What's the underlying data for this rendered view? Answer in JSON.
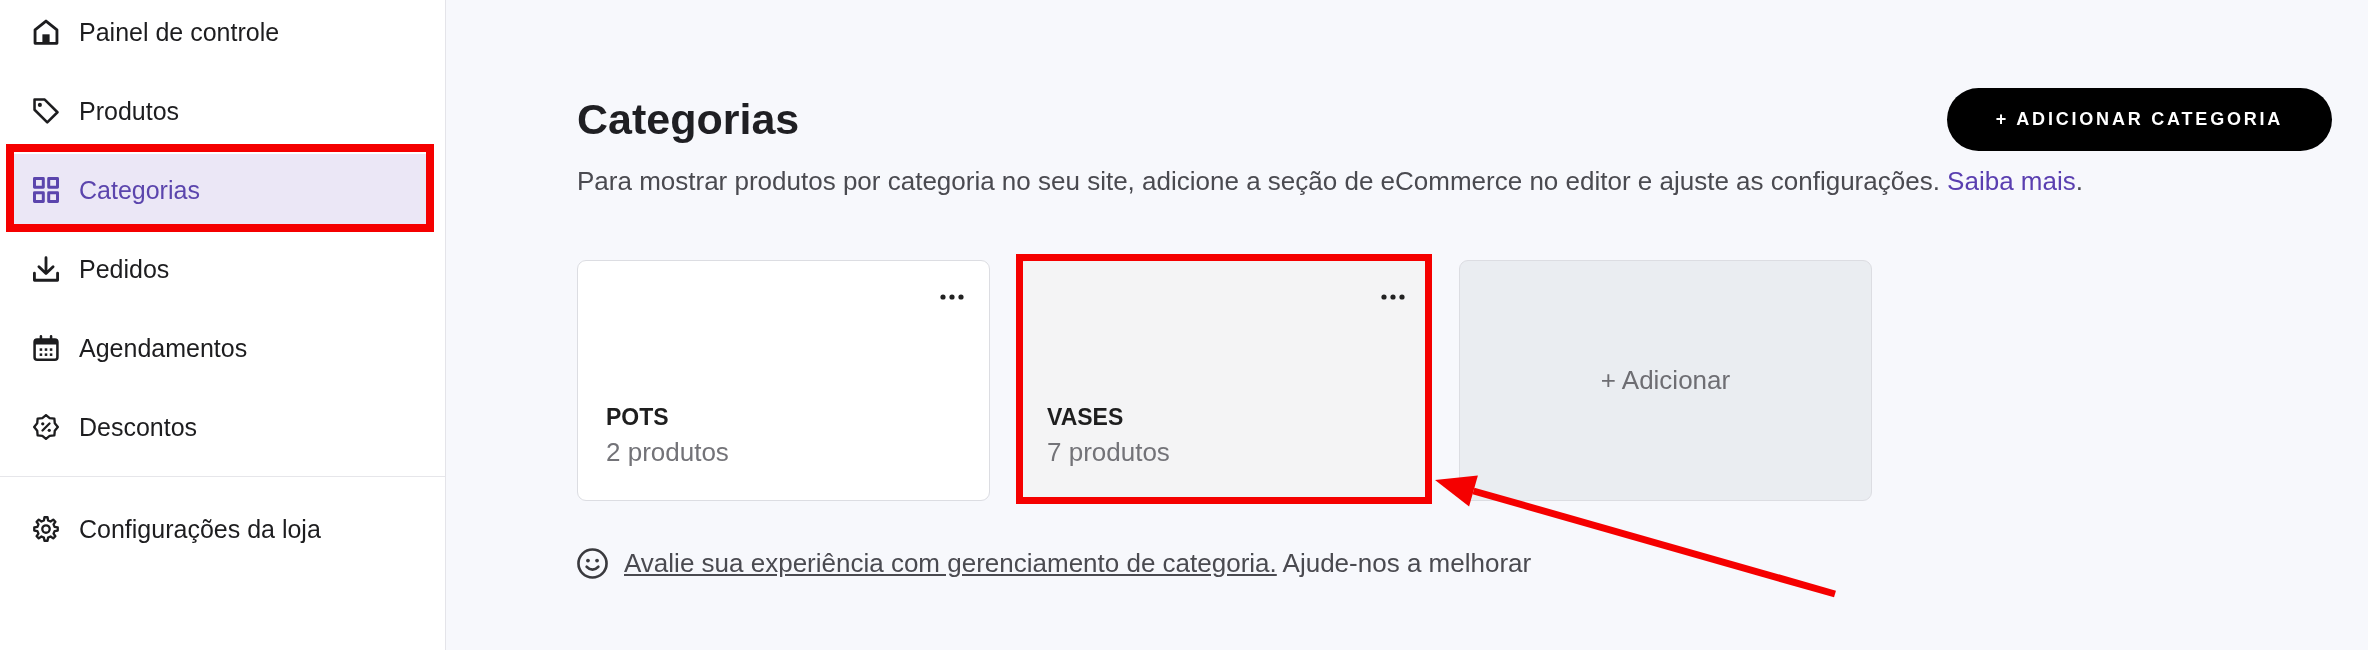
{
  "sidebar": {
    "groups": [
      {
        "items": [
          {
            "label": "Painel de controle",
            "selected": false,
            "highlighted": false
          },
          {
            "label": "Produtos",
            "selected": false,
            "highlighted": false
          },
          {
            "label": "Categorias",
            "selected": true,
            "highlighted": true
          },
          {
            "label": "Pedidos",
            "selected": false,
            "highlighted": false
          },
          {
            "label": "Agendamentos",
            "selected": false,
            "highlighted": false
          },
          {
            "label": "Descontos",
            "selected": false,
            "highlighted": false
          }
        ]
      },
      {
        "items": [
          {
            "label": "Configurações da loja",
            "selected": false,
            "highlighted": false
          }
        ]
      }
    ]
  },
  "header": {
    "title": "Categorias",
    "description": {
      "text": "Para mostrar produtos por categoria no seu site, adicione a seção de eCommerce no editor e ajuste as configurações.",
      "link": "Saiba mais",
      "suffix": "."
    },
    "add_button": "+ ADICIONAR CATEGORIA"
  },
  "categories": [
    {
      "name": "POTS",
      "count": "2 produtos",
      "hovered": false,
      "highlighted": false
    },
    {
      "name": "VASES",
      "count": "7 produtos",
      "hovered": true,
      "highlighted": true
    }
  ],
  "add_card": {
    "label": "+ Adicionar"
  },
  "feedback": {
    "link": "Avalie sua experiência com gerenciamento de categoria.",
    "text": "Ajude-nos a melhorar"
  },
  "annotations": [
    {
      "kind": "arrow"
    }
  ]
}
